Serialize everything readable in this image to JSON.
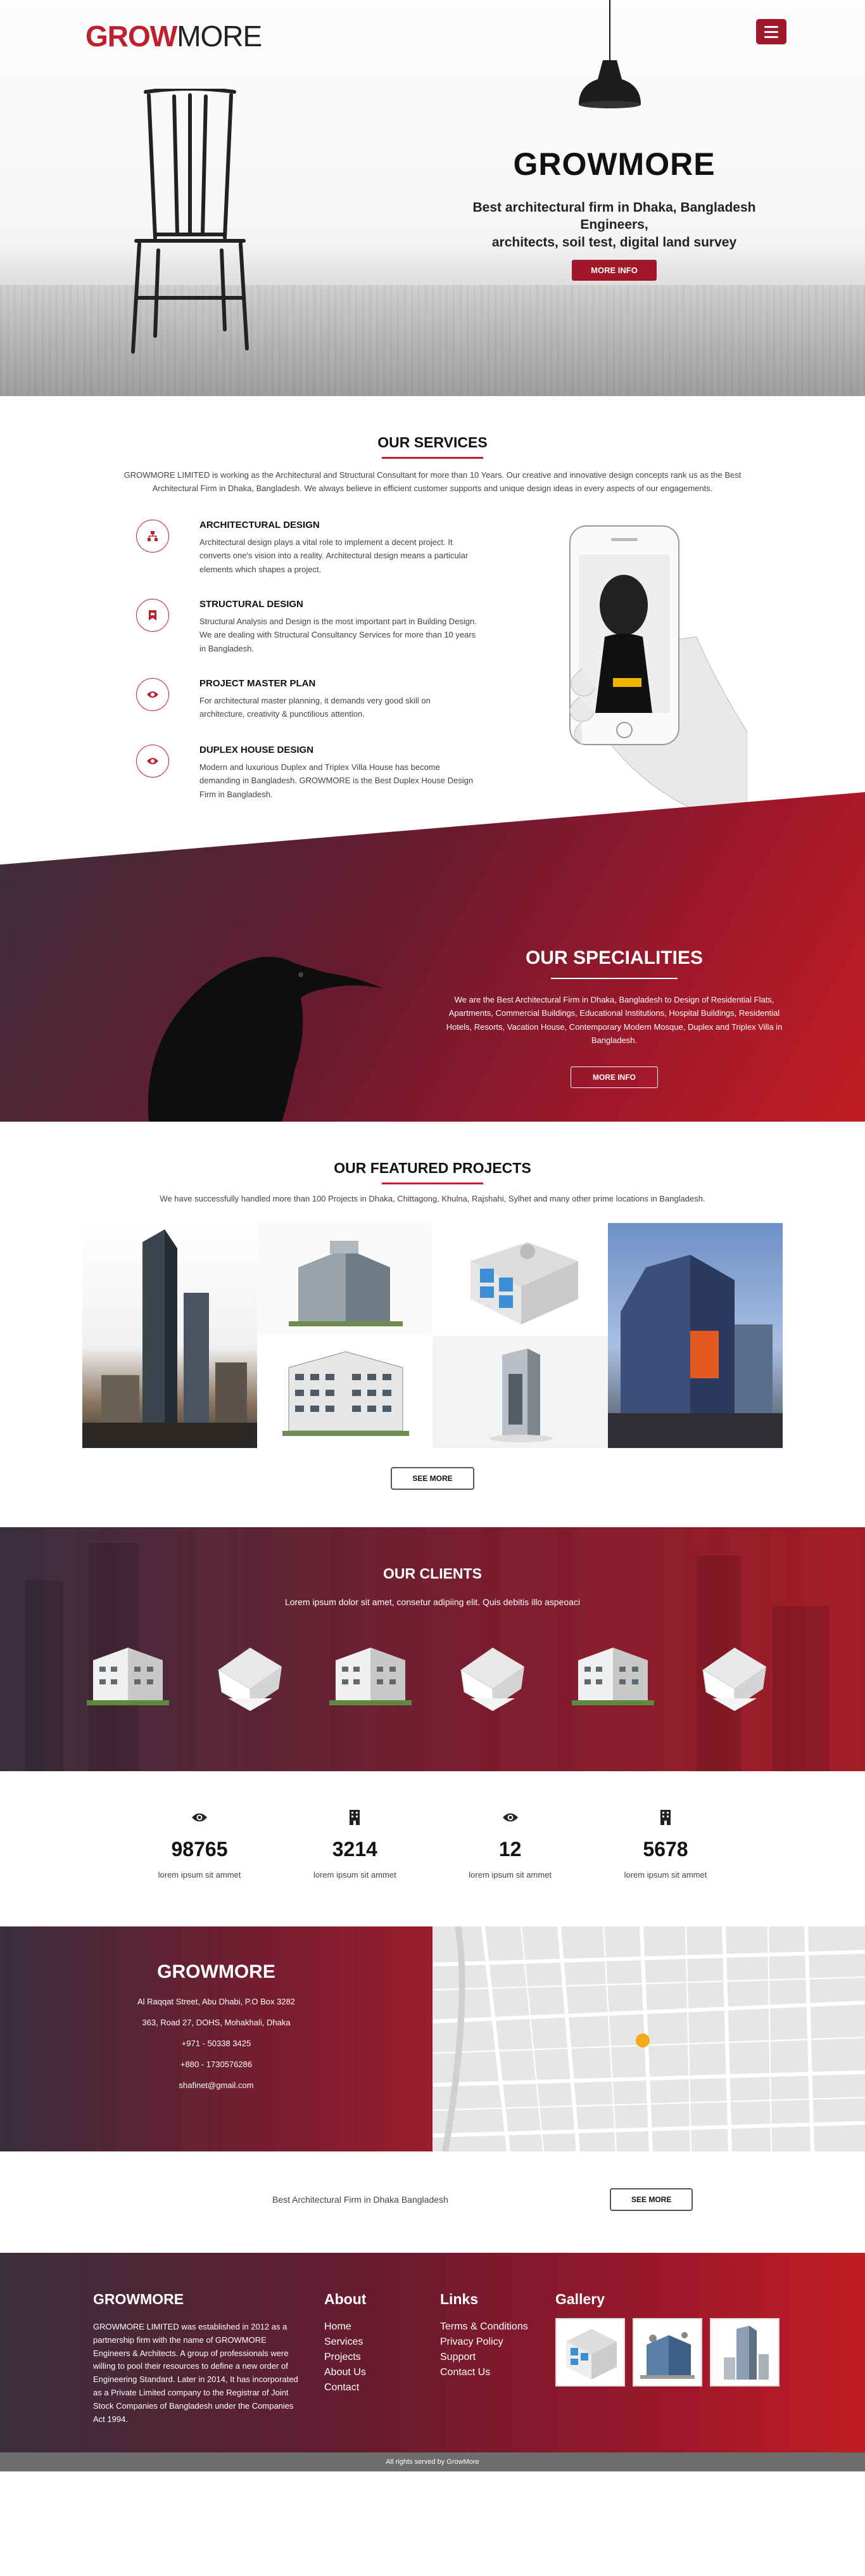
{
  "brand": {
    "logo_part1": "GROW",
    "logo_part2": "MORE",
    "color_primary": "#a1182a",
    "color_accent": "#c0202e"
  },
  "hero": {
    "title": "GROWMORE",
    "subtitle_line1": "Best architectural firm in Dhaka, Bangladesh Engineers,",
    "subtitle_line2": "architects, soil test, digital land survey",
    "button": "MORE INFO",
    "menu_icon": "hamburger-icon"
  },
  "services": {
    "heading": "OUR SERVICES",
    "intro_line1": "GROWMORE LIMITED is working as the Architectural and Structural Consultant for more than 10 Years. Our creative and innovative design concepts rank us as the Best",
    "intro_line2": "Architectural Firm in Dhaka, Bangladesh. We always believe in efficient customer supports and unique design ideas in every aspects of our engagements.",
    "items": [
      {
        "title": "ARCHITECTURAL DESIGN",
        "desc": "Architectural design plays a vital role to implement a decent project. It converts one's vision into a reality. Architectural design means a particular elements which shapes a project.",
        "icon": "sitemap-icon"
      },
      {
        "title": "STRUCTURAL DESIGN",
        "desc": "Structural Analysis and Design is the most important part in Building Design. We are dealing with Structural Consultancy Services for more than 10 years in Bangladesh.",
        "icon": "bookmark-icon"
      },
      {
        "title": "PROJECT MASTER PLAN",
        "desc": "For architectural master planning, it demands very good skill on architecture, creativity & punctilious attention.",
        "icon": "eye-icon"
      },
      {
        "title": "DUPLEX HOUSE DESIGN",
        "desc": "Modern and luxurious Duplex and Triplex Villa House has become demanding in Bangladesh. GROWMORE is the Best Duplex House Design Firm in Bangladesh.",
        "icon": "eye-icon"
      }
    ]
  },
  "specialities": {
    "heading": "OUR SPECIALITIES",
    "text": "We are the Best Architectural Firm in Dhaka, Bangladesh to Design of Residential Flats, Apartments, Commercial Buildings, Educational Institutions, Hospital Buildings, Residential Hotels, Resorts, Vacation House, Contemporary Modern Mosque, Duplex and Triplex Villa in Bangladesh.",
    "button": "MORE INFO"
  },
  "projects": {
    "heading": "OUR FEATURED PROJECTS",
    "intro": "We have successfully handled more than 100 Projects in Dhaka, Chittagong, Khulna, Rajshahi, Sylhet and many other prime locations in Bangladesh.",
    "button": "SEE MORE"
  },
  "clients": {
    "heading": "OUR CLIENTS",
    "subtitle": "Lorem ipsum dolor sit amet, consetur adipiing elit. Quis debitis illo aspeoaci"
  },
  "stats": [
    {
      "value": "98765",
      "label": "lorem ipsum sit ammet",
      "icon": "eye-icon"
    },
    {
      "value": "3214",
      "label": "lorem ipsum sit ammet",
      "icon": "building-icon"
    },
    {
      "value": "12",
      "label": "lorem ipsum sit ammet",
      "icon": "eye-icon"
    },
    {
      "value": "5678",
      "label": "lorem ipsum sit ammet",
      "icon": "building-icon"
    }
  ],
  "contact": {
    "title": "GROWMORE",
    "address1": "Al Raqqat Street, Abu Dhabi, P.O Box 3282",
    "address2": "363, Road 27, DOHS, Mohakhali, Dhaka",
    "phone1": "+971 - 50338 3425",
    "phone2": "+880 - 1730576286",
    "email": "shafinet@gmail.com"
  },
  "cta": {
    "text": "Best Architectural Firm in Dhaka Bangladesh",
    "button": "SEE MORE"
  },
  "footer": {
    "about_heading": "GROWMORE",
    "about_text": "GROWMORE LIMITED was established in 2012 as a partnership firm with the name of GROWMORE Engineers & Architects. A group of professionals were willing to pool their resources to define a new order of Engineering Standard. Later in 2014, It has incorporated as a Private Limited company to the Registrar of Joint Stock Companies of Bangladesh under the Companies Act 1994.",
    "about_col": {
      "heading": "About",
      "links": [
        "Home",
        "Services",
        "Projects",
        "About Us",
        "Contact"
      ]
    },
    "links_col": {
      "heading": "Links",
      "links": [
        "Terms & Conditions",
        "Privacy Policy",
        "Support",
        "Contact Us"
      ]
    },
    "gallery_heading": "Gallery",
    "copyright": "All rights served by GrowMore"
  }
}
